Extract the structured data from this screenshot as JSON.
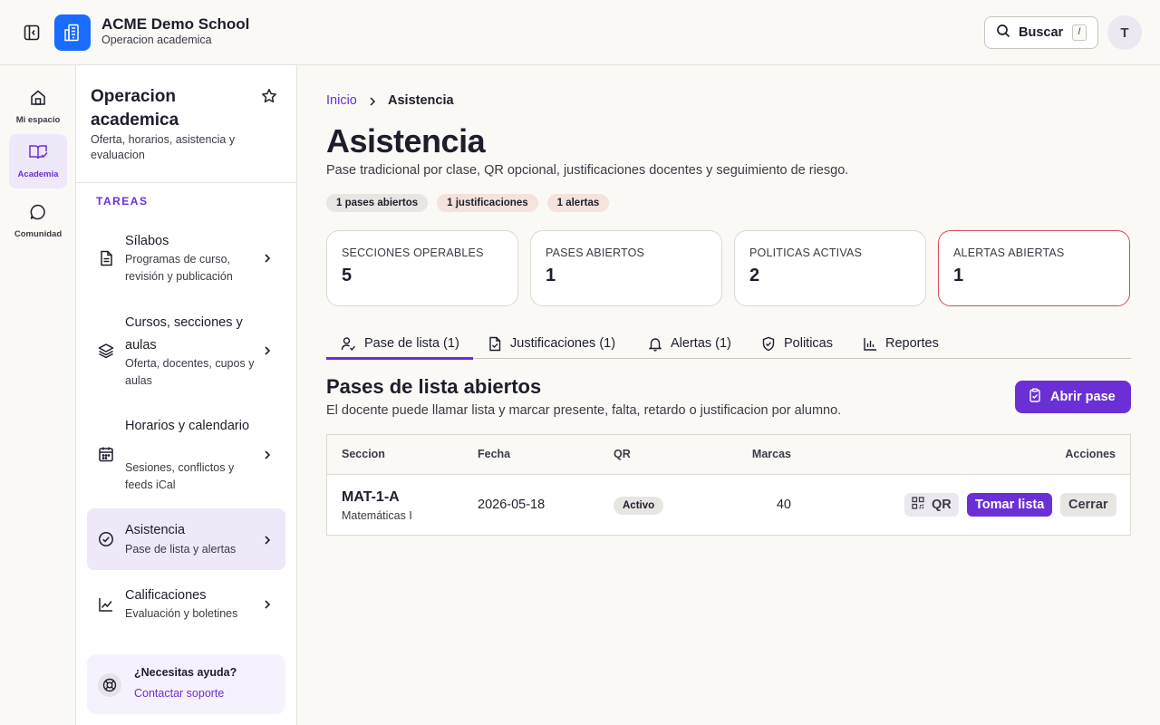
{
  "header": {
    "school_name": "ACME Demo School",
    "school_subtitle": "Operacion academica",
    "search_label": "Buscar",
    "search_shortcut": "/",
    "avatar_initial": "T"
  },
  "rail": {
    "items": [
      {
        "label": "Mi espacio",
        "icon": "home-icon"
      },
      {
        "label": "Academia",
        "icon": "book-check-icon",
        "active": true
      },
      {
        "label": "Comunidad",
        "icon": "chat-bubble-icon"
      }
    ]
  },
  "sidebar": {
    "title": "Operacion academica",
    "description": "Oferta, horarios, asistencia y evaluacion",
    "section_label": "TAREAS",
    "items": [
      {
        "title": "Sílabos",
        "subtitle": "Programas de curso, revisión y publicación",
        "icon": "document-icon"
      },
      {
        "title": "Cursos, secciones y aulas",
        "subtitle": "Oferta, docentes, cupos y aulas",
        "icon": "layers-icon"
      },
      {
        "title": "Horarios y calendario",
        "subtitle": "Sesiones, conflictos y feeds iCal",
        "icon": "calendar-icon"
      },
      {
        "title": "Asistencia",
        "subtitle": "Pase de lista y alertas",
        "icon": "check-circle-icon",
        "active": true
      },
      {
        "title": "Calificaciones",
        "subtitle": "Evaluación y boletines",
        "icon": "line-chart-icon"
      }
    ],
    "help": {
      "title": "¿Necesitas ayuda?",
      "link": "Contactar soporte"
    }
  },
  "breadcrumb": {
    "home": "Inicio",
    "current": "Asistencia"
  },
  "page": {
    "title": "Asistencia",
    "description": "Pase tradicional por clase, QR opcional, justificaciones docentes y seguimiento de riesgo.",
    "badges": [
      "1 pases abiertos",
      "1 justificaciones",
      "1 alertas"
    ]
  },
  "stats": [
    {
      "label": "SECCIONES OPERABLES",
      "value": "5"
    },
    {
      "label": "PASES ABIERTOS",
      "value": "1"
    },
    {
      "label": "POLITICAS ACTIVAS",
      "value": "2"
    },
    {
      "label": "ALERTAS ABIERTAS",
      "value": "1"
    }
  ],
  "tabs": [
    {
      "label": "Pase de lista (1)",
      "icon": "user-check-icon",
      "active": true
    },
    {
      "label": "Justificaciones (1)",
      "icon": "file-check-icon"
    },
    {
      "label": "Alertas (1)",
      "icon": "bell-icon"
    },
    {
      "label": "Politicas",
      "icon": "shield-check-icon"
    },
    {
      "label": "Reportes",
      "icon": "bar-chart-icon"
    }
  ],
  "section": {
    "title": "Pases de lista abiertos",
    "description": "El docente puede llamar lista y marcar presente, falta, retardo o justificacion por alumno.",
    "open_button": "Abrir pase"
  },
  "table": {
    "headers": [
      "Seccion",
      "Fecha",
      "QR",
      "Marcas",
      "Acciones"
    ],
    "rows": [
      {
        "section_code": "MAT-1-A",
        "section_name": "Matemáticas I",
        "date": "2026-05-18",
        "qr_status": "Activo",
        "marks": "40",
        "actions": {
          "qr": "QR",
          "take": "Tomar lista",
          "close": "Cerrar"
        }
      }
    ]
  },
  "colors": {
    "accent": "#6b2fd6",
    "brand": "#1a6bff",
    "alert_border": "#d8495b"
  }
}
